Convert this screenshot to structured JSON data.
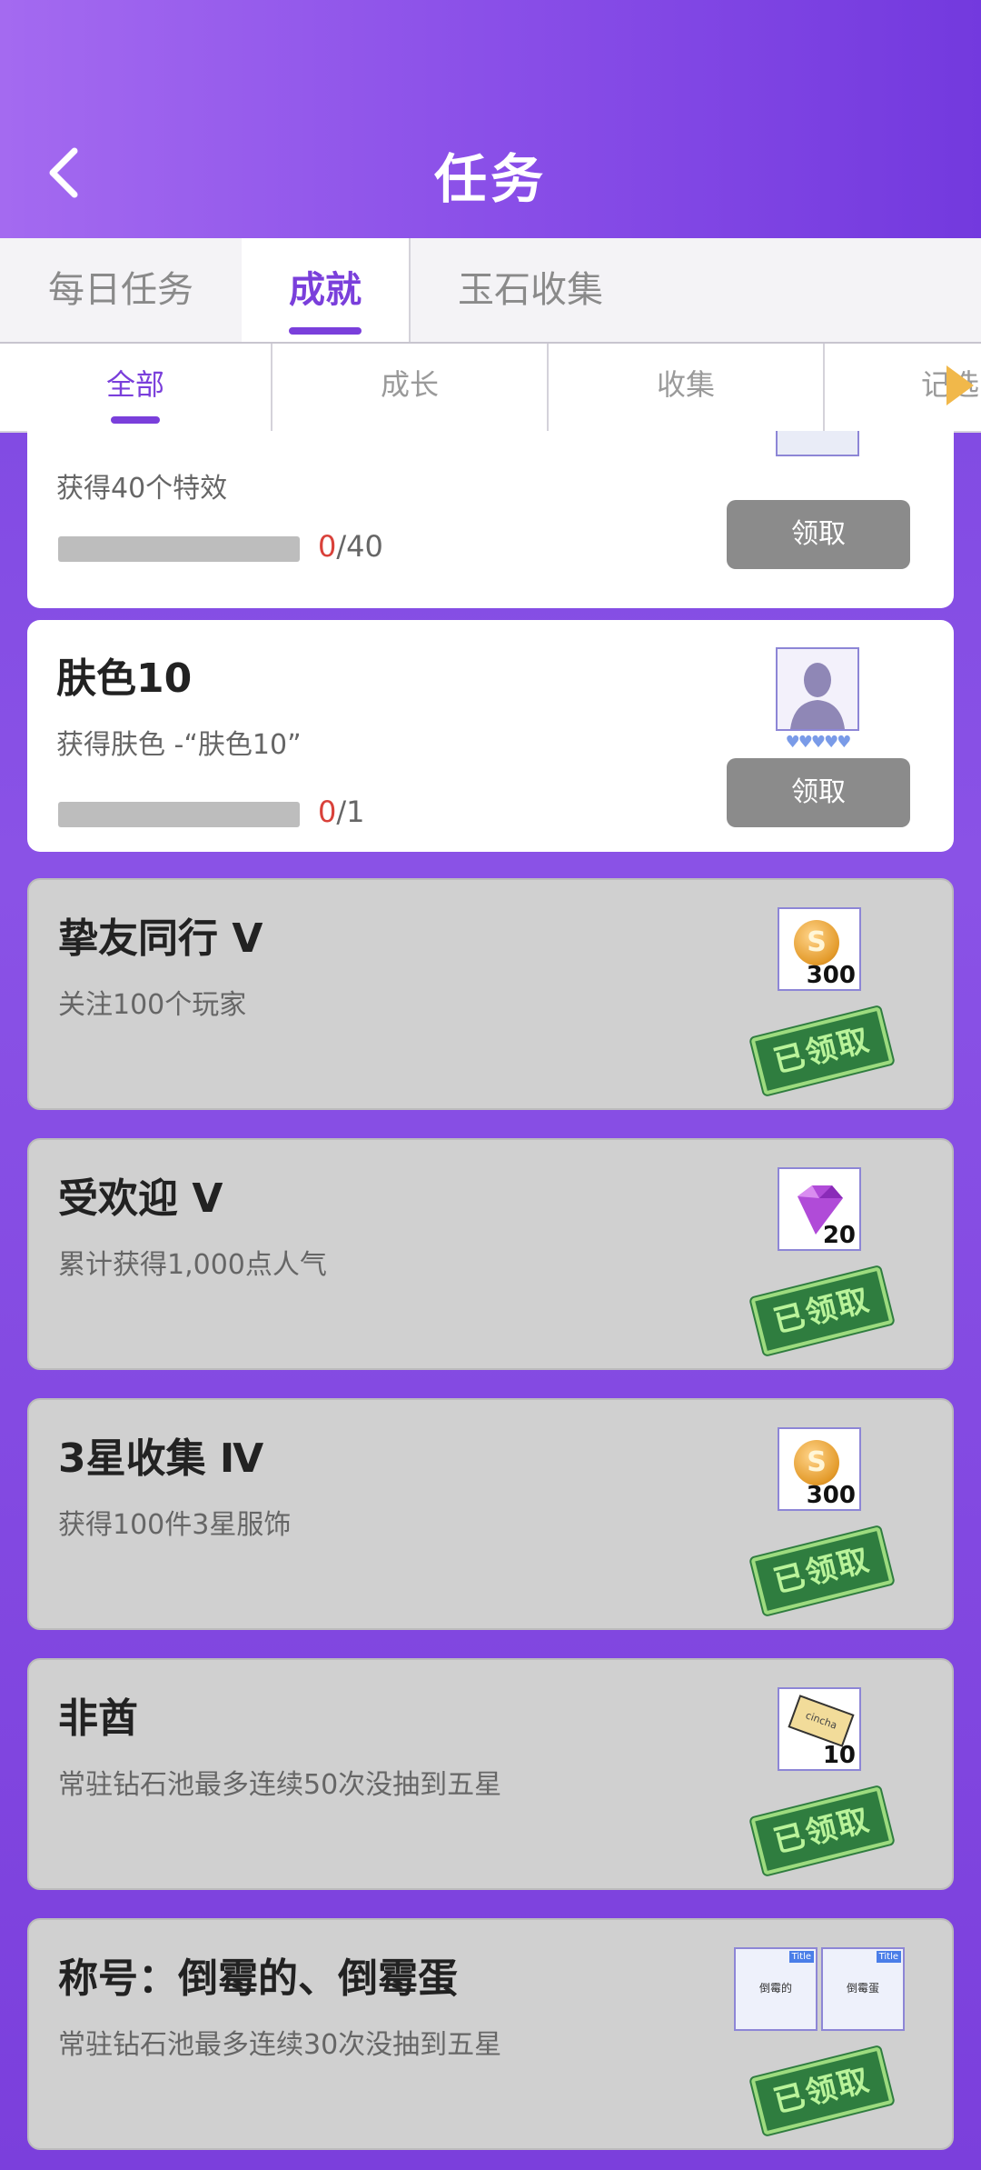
{
  "header": {
    "title": "任务",
    "back_icon": "chevron-left-icon"
  },
  "main_tabs": [
    {
      "label": "每日任务",
      "active": false
    },
    {
      "label": "成就",
      "active": true
    },
    {
      "label": "玉石收集",
      "active": false
    }
  ],
  "sub_tabs": [
    {
      "label": "全部",
      "active": true
    },
    {
      "label": "成长",
      "active": false
    },
    {
      "label": "收集",
      "active": false
    },
    {
      "label": "记选",
      "active": false
    }
  ],
  "cards": [
    {
      "name": "",
      "desc": "获得40个特效",
      "progress": {
        "current": "0",
        "total": "/40",
        "fraction": 0
      },
      "claim_label": "领取",
      "status": "open",
      "reward": {
        "icon": "title-card-icon",
        "qty": ""
      }
    },
    {
      "name": "肤色10",
      "desc": "获得肤色 -“肤色10”",
      "progress": {
        "current": "0",
        "total": "/1",
        "fraction": 0
      },
      "claim_label": "领取",
      "status": "open",
      "reward": {
        "icon": "skin-tone-avatar-icon",
        "qty": "",
        "hearts": "♥♥♥♥♥"
      }
    },
    {
      "name": "挚友同行 Ⅴ",
      "desc": "关注100个玩家",
      "status": "claimed",
      "stamp_label": "已领取",
      "reward": {
        "icon": "gold-coin-icon",
        "qty": "300"
      }
    },
    {
      "name": "受欢迎 Ⅴ",
      "desc": "累计获得1,000点人气",
      "status": "claimed",
      "stamp_label": "已领取",
      "reward": {
        "icon": "purple-diamond-icon",
        "qty": "20"
      }
    },
    {
      "name": "3星收集 Ⅳ",
      "desc": "获得100件3星服饰",
      "status": "claimed",
      "stamp_label": "已领取",
      "reward": {
        "icon": "gold-coin-icon",
        "qty": "300"
      }
    },
    {
      "name": "非酋",
      "desc": "常驻钻石池最多连续50次没抽到五星",
      "status": "claimed",
      "stamp_label": "已领取",
      "reward": {
        "icon": "gacha-ticket-icon",
        "qty": "10",
        "ticket_text": "cincha"
      }
    },
    {
      "name": "称号：倒霉的、倒霉蛋",
      "desc": "常驻钻石池最多连续30次没抽到五星",
      "status": "claimed",
      "stamp_label": "已领取",
      "reward": {
        "icon": "title-badge-icon",
        "badges": [
          {
            "tag": "Title",
            "text": "倒霉的"
          },
          {
            "tag": "Title",
            "text": "倒霉蛋"
          }
        ]
      }
    }
  ],
  "colors": {
    "accent": "#7a3fdb",
    "progress_current": "#d9413a",
    "stamp_green": "#2f7d3f"
  }
}
